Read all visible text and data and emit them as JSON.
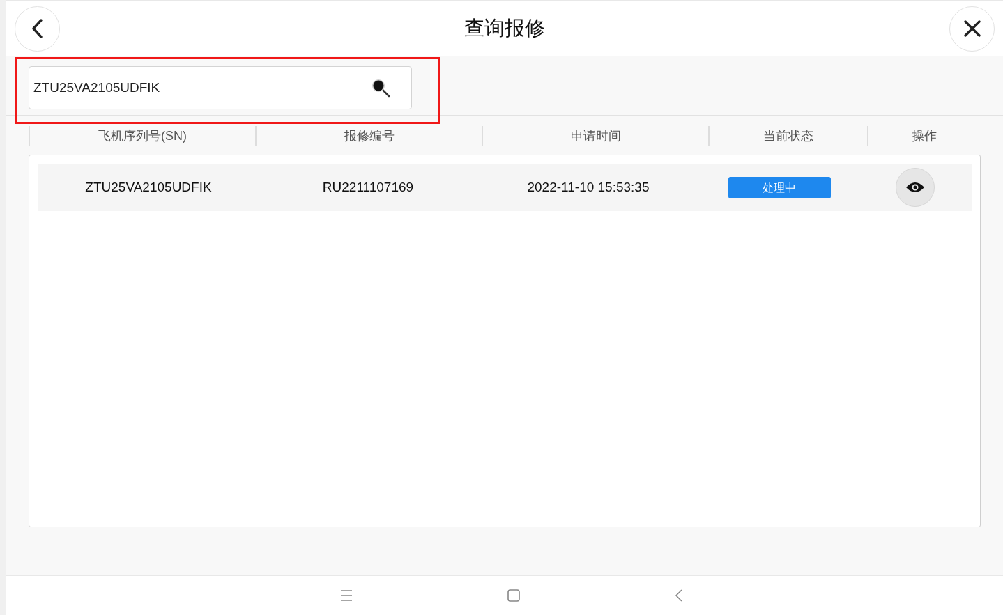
{
  "header": {
    "title": "查询报修"
  },
  "search": {
    "value": "ZTU25VA2105UDFIK"
  },
  "table": {
    "columns": [
      "飞机序列号(SN)",
      "报修编号",
      "申请时间",
      "当前状态",
      "操作"
    ],
    "rows": [
      {
        "sn": "ZTU25VA2105UDFIK",
        "repair_no": "RU2211107169",
        "time": "2022-11-10 15:53:35",
        "status": {
          "label": "处理中",
          "kind": "processing"
        }
      }
    ]
  }
}
